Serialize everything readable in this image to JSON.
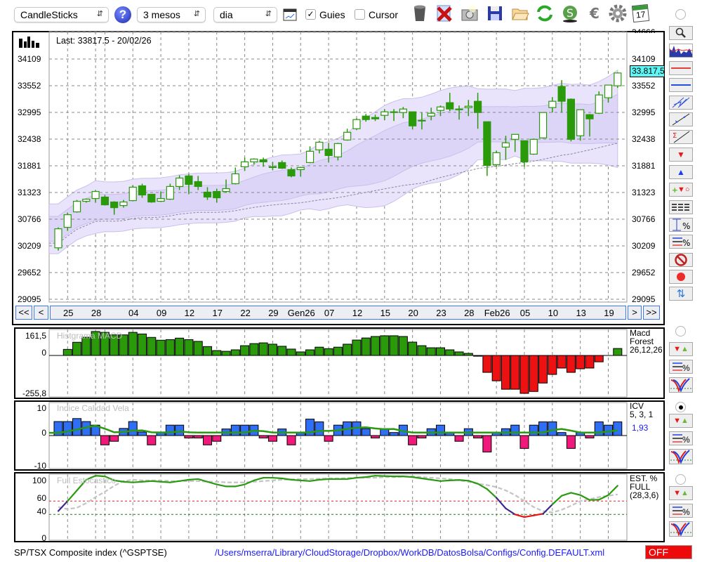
{
  "toolbar": {
    "chart_type": "CandleSticks",
    "period": "3 mesos",
    "interval": "dia",
    "guides_label": "Guies",
    "guides_checked": true,
    "cursor_label": "Cursor",
    "cursor_checked": false,
    "icons": [
      "help-icon",
      "chart-window-icon",
      "trash-icon",
      "delete-icon",
      "camera-icon",
      "save-icon",
      "folder-open-icon",
      "refresh-icon",
      "currency-s-icon",
      "euro-icon",
      "gear-icon",
      "calendar-icon"
    ],
    "calendar_day": "17"
  },
  "main_chart": {
    "last_label": "Last: 33817.5 - 20/02/26",
    "price_tag": "33.817,5",
    "y_ticks": [
      "34666",
      "34109",
      "33552",
      "32995",
      "32438",
      "31881",
      "31323",
      "30766",
      "30209",
      "29652",
      "29095"
    ],
    "y_tick_values": [
      34666,
      34109,
      33552,
      32995,
      32438,
      31881,
      31323,
      30766,
      30209,
      29652,
      29095
    ],
    "nav": {
      "first": "<<",
      "prev": "<",
      "next": ">",
      "last": ">>"
    },
    "date_labels": [
      {
        "label": "25",
        "index": 1
      },
      {
        "label": "28",
        "index": 4
      },
      {
        "label": "04",
        "index": 8
      },
      {
        "label": "09",
        "index": 11
      },
      {
        "label": "12",
        "index": 14
      },
      {
        "label": "17",
        "index": 17
      },
      {
        "label": "22",
        "index": 20
      },
      {
        "label": "29",
        "index": 23
      },
      {
        "label": "Gen26",
        "index": 26
      },
      {
        "label": "07",
        "index": 29
      },
      {
        "label": "12",
        "index": 32
      },
      {
        "label": "15",
        "index": 35
      },
      {
        "label": "20",
        "index": 38
      },
      {
        "label": "23",
        "index": 41
      },
      {
        "label": "28",
        "index": 44
      },
      {
        "label": "Feb26",
        "index": 47
      },
      {
        "label": "05",
        "index": 50
      },
      {
        "label": "10",
        "index": 53
      },
      {
        "label": "13",
        "index": 56
      },
      {
        "label": "19",
        "index": 59
      }
    ],
    "extra_grid_index": 5,
    "colors": {
      "candle": "#2a9a0a",
      "band_outer": "#e9e4fb",
      "band_inner": "#ddd5f8",
      "price_tag": "#5ff5f5"
    }
  },
  "chart_data": [
    {
      "type": "candlestick",
      "ylim": [
        29095,
        34666
      ],
      "open": [
        30169,
        30596,
        30919,
        31140,
        31198,
        31228,
        31125,
        31051,
        31154,
        31463,
        31287,
        31140,
        31184,
        31449,
        31669,
        31551,
        31331,
        31345,
        31345,
        31507,
        31860,
        31963,
        32007,
        31860,
        31948,
        31801,
        31801,
        31948,
        32213,
        32227,
        32066,
        32419,
        32654,
        32918,
        32889,
        32933,
        33007,
        32992,
        33007,
        32830,
        32918,
        33036,
        33198,
        33065,
        33095,
        33227,
        32800,
        31904,
        32271,
        32433,
        32404,
        32124,
        32463,
        33095,
        33536,
        33271,
        32507,
        32948,
        32977,
        33300,
        33550
      ],
      "high": [
        30596,
        30904,
        31169,
        31198,
        31375,
        31272,
        31140,
        31169,
        31478,
        31507,
        31287,
        31345,
        31507,
        31684,
        31713,
        31669,
        31434,
        31404,
        31595,
        31845,
        32051,
        32036,
        32051,
        31963,
        31992,
        31845,
        31860,
        32286,
        32404,
        32360,
        32360,
        32654,
        32874,
        32962,
        32948,
        33065,
        33065,
        33109,
        33007,
        32992,
        33095,
        33139,
        33404,
        33139,
        33256,
        33404,
        32800,
        32198,
        32507,
        32536,
        32404,
        32448,
        32992,
        33315,
        33668,
        33286,
        33051,
        32962,
        33433,
        33565,
        33833
      ],
      "low": [
        30111,
        30522,
        30904,
        31110,
        31110,
        31051,
        30860,
        31007,
        31140,
        31213,
        31110,
        31125,
        31169,
        31375,
        31287,
        31375,
        31169,
        31110,
        31316,
        31492,
        31772,
        31904,
        31860,
        31786,
        31816,
        31640,
        31654,
        31933,
        32139,
        31948,
        31992,
        32404,
        32624,
        32801,
        32815,
        32830,
        32815,
        32874,
        32639,
        32639,
        32830,
        32918,
        33021,
        32845,
        32918,
        32654,
        31669,
        31860,
        32007,
        32169,
        31860,
        32110,
        32448,
        32992,
        32992,
        32389,
        32404,
        32492,
        32962,
        33198,
        33506
      ],
      "close": [
        30566,
        30860,
        31140,
        31184,
        31345,
        31066,
        31007,
        31125,
        31434,
        31272,
        31125,
        31198,
        31449,
        31625,
        31492,
        31449,
        31228,
        31213,
        31404,
        31713,
        31963,
        32022,
        31963,
        31860,
        31830,
        31669,
        31845,
        32183,
        32373,
        32095,
        32345,
        32580,
        32845,
        32845,
        32860,
        33007,
        33007,
        33065,
        32713,
        32830,
        32977,
        33109,
        33065,
        33065,
        33124,
        32992,
        31889,
        32154,
        32360,
        32536,
        31963,
        32433,
        32992,
        33227,
        33227,
        32433,
        33051,
        32860,
        33359,
        33565,
        33817.5
      ]
    },
    {
      "type": "bar",
      "title": "Histgrama MACD",
      "ylim": [
        -255.8,
        161.5
      ],
      "y_ticks": [
        "161,5",
        "0",
        "-255,8"
      ],
      "values": [
        0,
        41,
        89,
        123,
        161.5,
        156,
        139,
        139,
        156,
        145,
        122,
        103,
        107,
        117,
        107,
        95,
        60,
        33,
        28,
        38,
        66,
        80,
        85,
        76,
        62,
        43,
        24,
        38,
        56,
        46,
        56,
        76,
        104,
        118,
        128,
        133,
        133,
        128,
        90,
        66,
        52,
        52,
        38,
        24,
        14,
        -5,
        -114,
        -171,
        -228,
        -228,
        -255.8,
        -243,
        -186,
        -128,
        -85,
        -114,
        -90,
        -85,
        -43,
        0,
        47
      ],
      "colors": {
        "positive": "#2a9a0a",
        "negative": "#ee1111"
      }
    },
    {
      "type": "bar",
      "title": "Indice Calidad Vela",
      "ylim": [
        -10,
        10
      ],
      "y_ticks": [
        "10",
        "0",
        "-10"
      ],
      "values": [
        5.1,
        5.1,
        6.2,
        5.1,
        3.8,
        -3.4,
        -2.1,
        2.6,
        5.1,
        1.3,
        -3.4,
        1.3,
        3.8,
        3.8,
        -0.9,
        -0.9,
        -3.4,
        -2.1,
        2.4,
        3.8,
        3.8,
        3.8,
        -0.9,
        -2.1,
        2.4,
        -3.4,
        0.9,
        6,
        5,
        -2.1,
        3.8,
        5,
        5,
        2.5,
        -0.9,
        2.5,
        1.1,
        3.8,
        -3.4,
        -0.9,
        2.5,
        3.8,
        1.1,
        -2.1,
        2.5,
        -0.9,
        -6,
        1.1,
        2.5,
        3.8,
        -4.7,
        3.8,
        5,
        5,
        1.1,
        -4.7,
        1.1,
        -0.9,
        5,
        3.8,
        5
      ],
      "signal": [
        1.0,
        1.5,
        2.2,
        3.0,
        3.6,
        2.5,
        1.2,
        1.3,
        1.8,
        1.9,
        1.2,
        1.1,
        1.2,
        1.5,
        1.2,
        1.1,
        1.1,
        1.1,
        1.1,
        1.1,
        1.1,
        1.8,
        1.6,
        1.1,
        1.1,
        1.1,
        1.1,
        1.2,
        1.7,
        1.7,
        1.9,
        2.4,
        2.9,
        3.0,
        2.6,
        2.3,
        2.4,
        1.6,
        1.1,
        1.1,
        1.1,
        1.1,
        1.1,
        1.1,
        1.1,
        1.1,
        1.1,
        1.1,
        1.1,
        1.1,
        1.1,
        1.1,
        1.1,
        2.0,
        2.4,
        1.8,
        1.1,
        1.1,
        1.1,
        1.5,
        1.93
      ],
      "colors": {
        "positive": "#2f6ff5",
        "negative": "#f0187a",
        "signal": "#2a9a10"
      }
    },
    {
      "type": "line",
      "title": "Full Estocastico",
      "ylim": [
        0,
        100
      ],
      "y_ticks": [
        "100",
        "60",
        "40",
        "0"
      ],
      "levels": [
        60,
        40
      ],
      "k": [
        45,
        60,
        76,
        92,
        98,
        97,
        91,
        89,
        88,
        89,
        90,
        89,
        88,
        90,
        92,
        93,
        89,
        85,
        82,
        82,
        85,
        91,
        95,
        95,
        94,
        92,
        91,
        90,
        92,
        93,
        93,
        93,
        95,
        96,
        98,
        97.5,
        97,
        97,
        96,
        94,
        92,
        90,
        91,
        91.6,
        90.5,
        86,
        78,
        65,
        49,
        40,
        36,
        38.5,
        41,
        55,
        68,
        72.5,
        69,
        61.7,
        62,
        69,
        83
      ],
      "d": [
        51,
        48,
        50,
        57,
        66,
        74,
        83,
        90,
        92,
        91,
        91,
        91,
        90,
        90,
        90,
        90,
        89,
        89,
        88,
        88,
        88,
        89,
        90,
        91,
        92,
        92.5,
        93,
        93,
        93.5,
        94,
        94,
        94.5,
        95,
        95,
        95,
        96,
        96,
        96.5,
        97,
        96,
        95,
        94,
        93,
        91,
        89,
        86,
        84,
        81,
        76,
        69,
        60,
        51,
        45,
        43,
        47,
        53,
        60,
        63,
        66,
        68,
        70
      ],
      "colors": {
        "k_high": "#2a9a10",
        "k_mid": "#3b2a8f",
        "k_low": "#ee1111",
        "d": "#c4c4c4",
        "level_high": "#e02020",
        "level_low": "#1a7a1a"
      }
    }
  ],
  "panels": {
    "macd": {
      "name_lines": [
        "Macd",
        "Forest",
        "26,12,26"
      ]
    },
    "icv": {
      "name_lines": [
        "ICV",
        "5, 3, 1"
      ],
      "value": "1,93"
    },
    "stoch": {
      "name_lines": [
        "EST. %",
        "FULL",
        "(28,3,6)"
      ]
    }
  },
  "status": {
    "symbol": "SP/TSX Composite index (^GSPTSE)",
    "config_path": "/Users/mserra/Library/CloudStorage/Dropbox/WorkDB/DatosBolsa/Configs/Config.DEFAULT.xml",
    "off_label": "OFF"
  }
}
